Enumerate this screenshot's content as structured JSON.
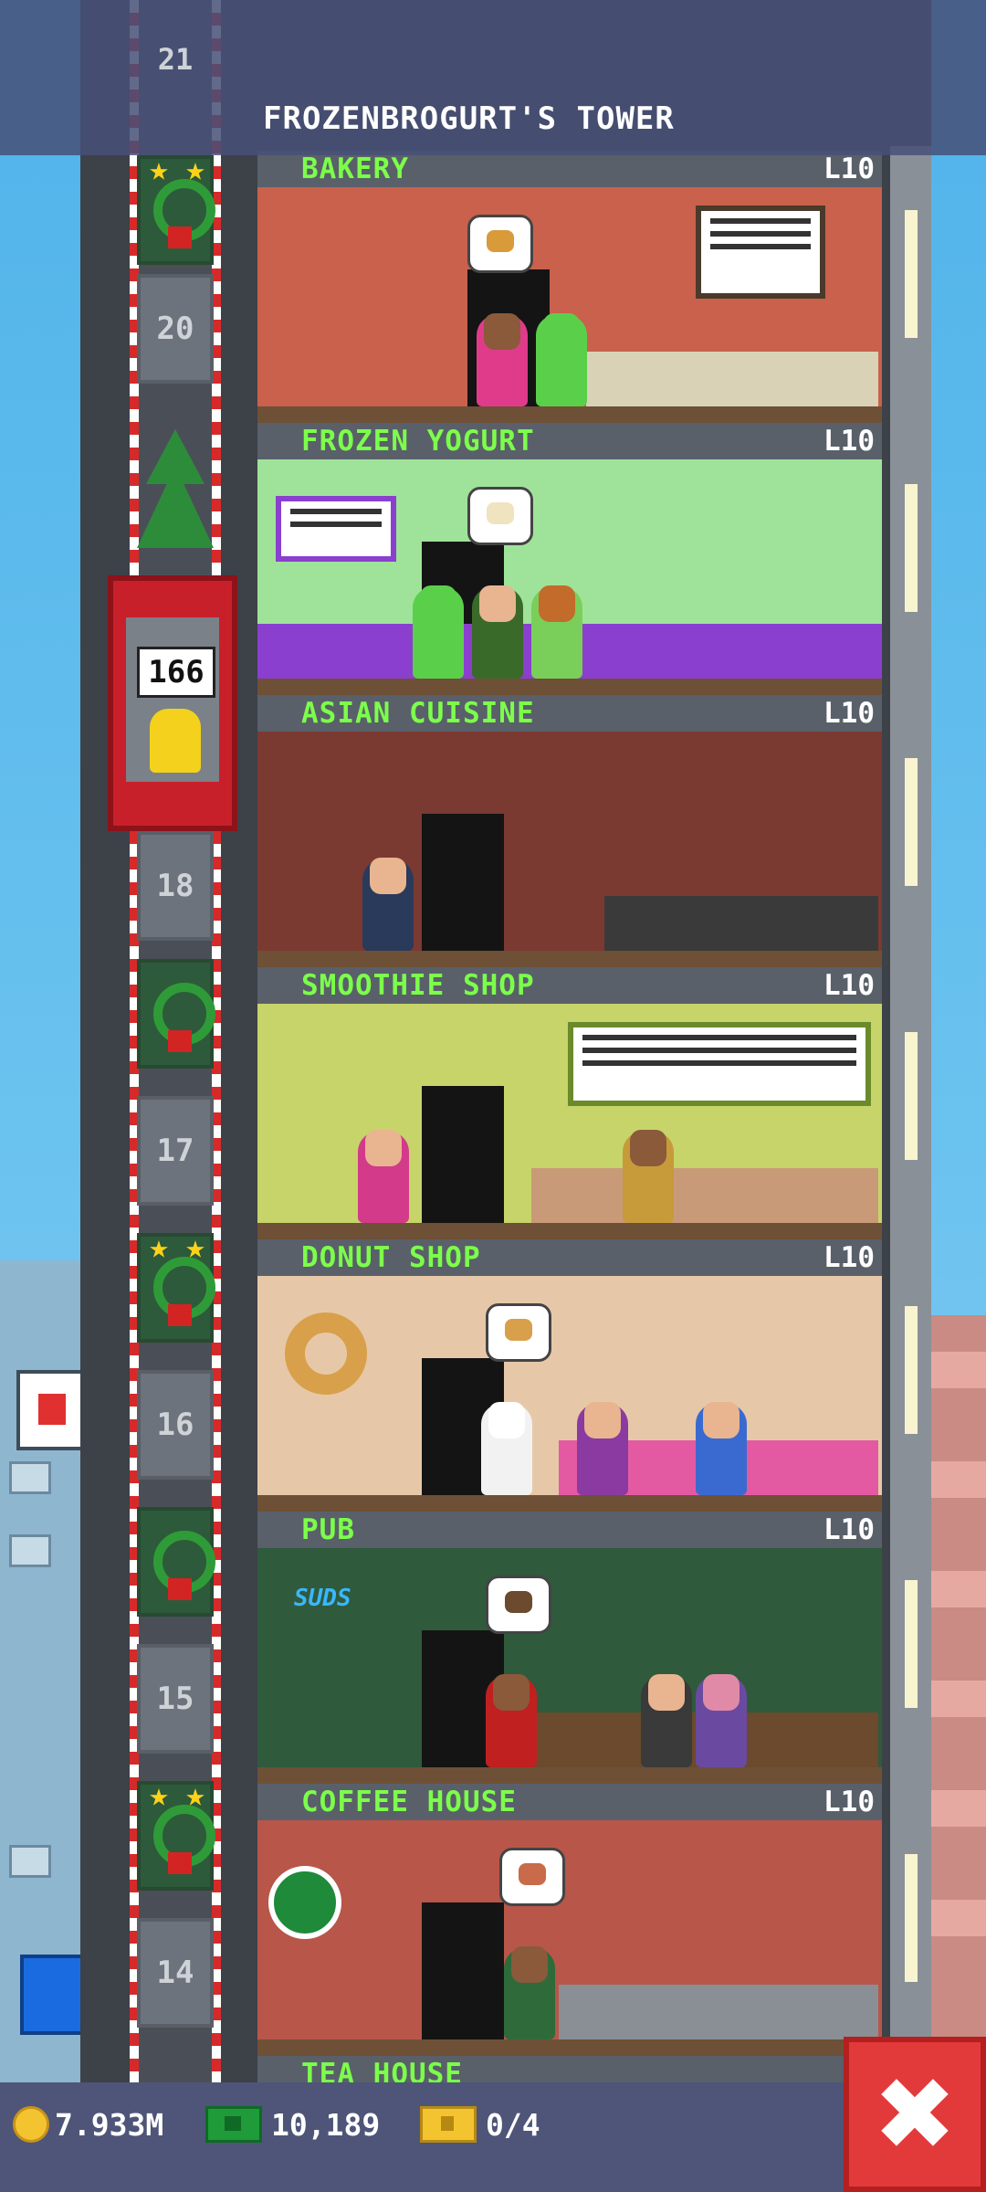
{
  "tower": {
    "title": "FROZENBROGURT'S TOWER",
    "top_floor": "21"
  },
  "elevator": {
    "counter": "166"
  },
  "shaft_floor_numbers": [
    "20",
    "18",
    "17",
    "16",
    "15",
    "14"
  ],
  "floors": [
    {
      "name": "BAKERY",
      "level": "L10",
      "wall": "#c9614d",
      "counter": "#d9d2b7"
    },
    {
      "name": "FROZEN YOGURT",
      "level": "L10",
      "wall": "#9fe39a",
      "counter": "#8a3fcf"
    },
    {
      "name": "ASIAN CUISINE",
      "level": "L10",
      "wall": "#7a3a32",
      "counter": "#3a3a3a"
    },
    {
      "name": "SMOOTHIE SHOP",
      "level": "L10",
      "wall": "#c7d46a",
      "counter": "#c99a78"
    },
    {
      "name": "DONUT SHOP",
      "level": "L10",
      "wall": "#e6c8a8",
      "counter": "#e35aa3"
    },
    {
      "name": "PUB",
      "level": "L10",
      "wall": "#2f5a3c",
      "counter": "#6b4a2d"
    },
    {
      "name": "COFFEE HOUSE",
      "level": "L10",
      "wall": "#b8564a",
      "counter": "#8a8f96"
    }
  ],
  "next_floor": {
    "name": "TEA HOUSE"
  },
  "pub_sign": "SUDS",
  "bottom_bar": {
    "coins": "7.933M",
    "bux": "10,189",
    "tickets": "0/4"
  },
  "icons": {
    "coins": "coin-icon",
    "bux": "cash-icon",
    "tickets": "ticket-icon",
    "close": "close-icon"
  },
  "colors": {
    "floor_name": "#7cff4a",
    "close_button": "#e23a3a",
    "elevator": "#c8202a"
  }
}
